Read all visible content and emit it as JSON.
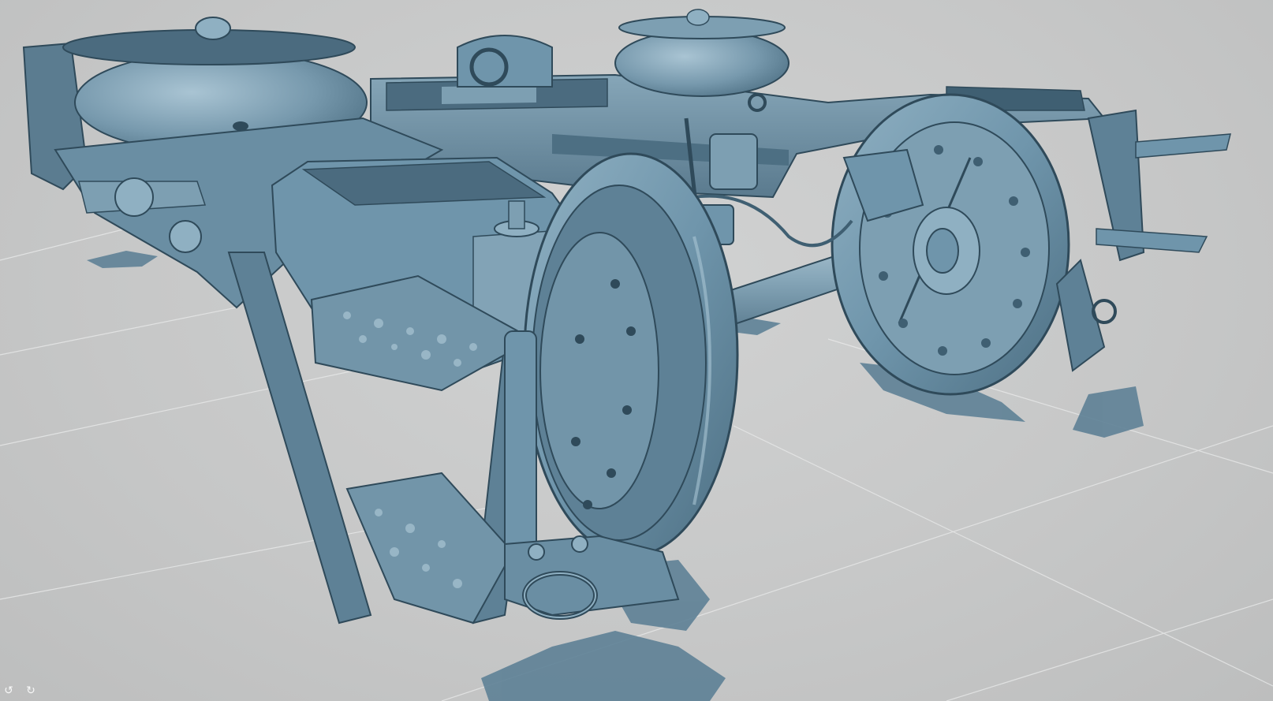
{
  "viewer": {
    "background_color": "#c8c9c9",
    "grid_color": "#e6e7e7",
    "mesh_color": "#6f95ab",
    "mesh_shadow_color": "#3f5f72",
    "mesh_highlight_color": "#a9c4d3",
    "mesh_outline_color": "#2f4a5a",
    "model": "bogie-3d-scan",
    "grid": true
  },
  "controls": {
    "undo_icon": "undo-icon",
    "redo_icon": "redo-icon"
  }
}
